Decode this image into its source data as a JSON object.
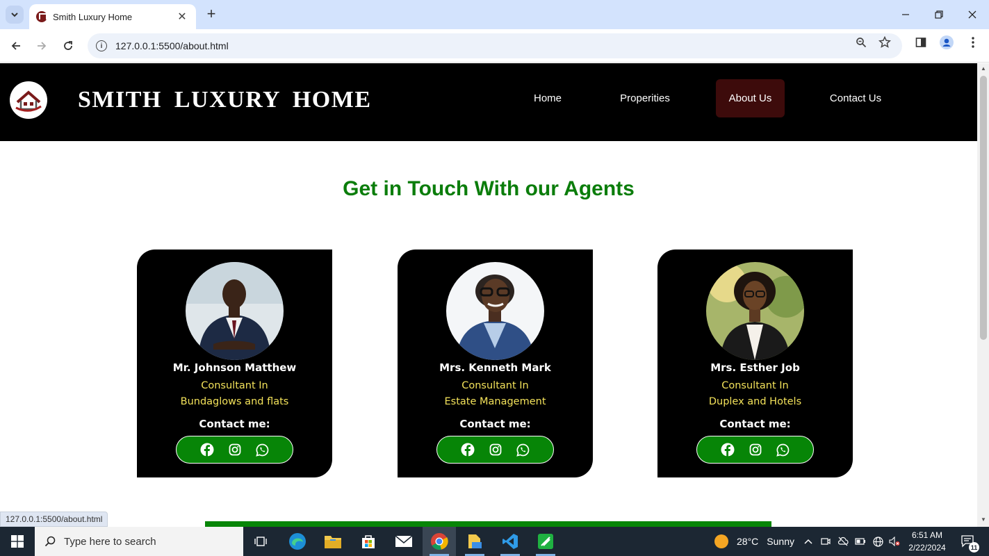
{
  "browser": {
    "tab_title": "Smith Luxury Home",
    "url": "127.0.0.1:5500/about.html",
    "status_url": "127.0.0.1:5500/about.html"
  },
  "site": {
    "brand": "SMITH LUXURY HOME",
    "nav": [
      {
        "label": "Home",
        "active": false
      },
      {
        "label": "Properities",
        "active": false
      },
      {
        "label": "About Us",
        "active": true
      },
      {
        "label": "Contact Us",
        "active": false
      }
    ],
    "section_title": "Get in Touch With our Agents",
    "agents": [
      {
        "name": "Mr. Johnson Matthew",
        "role_line1": "Consultant In",
        "role_line2": "Bundaglows and flats",
        "contact_label": "Contact me:"
      },
      {
        "name": "Mrs. Kenneth Mark",
        "role_line1": "Consultant In",
        "role_line2": "Estate Management",
        "contact_label": "Contact me:"
      },
      {
        "name": "Mrs. Esther Job",
        "role_line1": "Consultant In",
        "role_line2": "Duplex and Hotels",
        "contact_label": "Contact me:"
      }
    ],
    "colors": {
      "header_bg": "#000000",
      "title_green": "#0b7d0b",
      "role_yellow": "#f3e25a",
      "social_green": "#078507",
      "active_nav": "#3d0b0b"
    }
  },
  "taskbar": {
    "search_placeholder": "Type here to search",
    "weather_temp": "28°C",
    "weather_text": "Sunny",
    "time": "6:51 AM",
    "date": "2/22/2024",
    "notification_count": "11"
  }
}
